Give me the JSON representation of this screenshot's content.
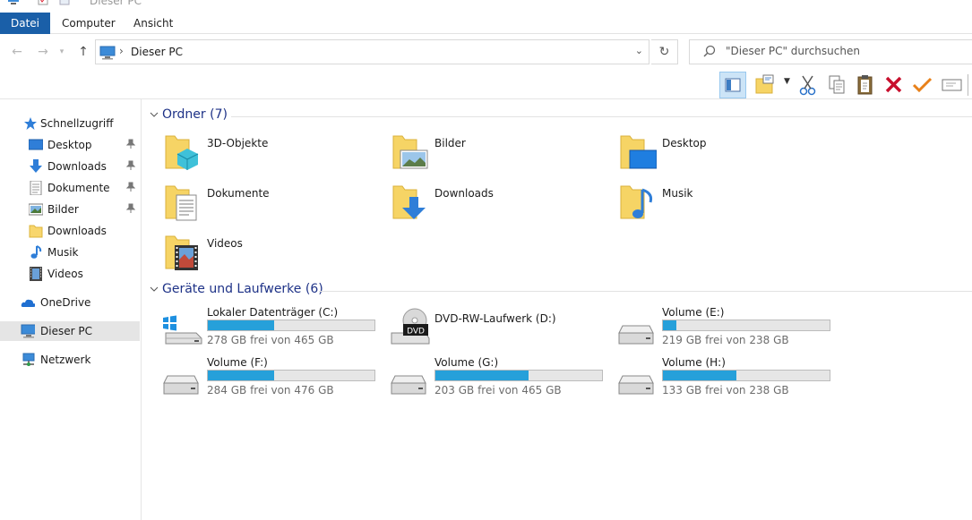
{
  "window": {
    "title": "Dieser PC"
  },
  "ribbon": {
    "tabs": [
      "Datei",
      "Computer",
      "Ansicht"
    ]
  },
  "address": {
    "path": "Dieser PC"
  },
  "search": {
    "placeholder": "\"Dieser PC\" durchsuchen"
  },
  "sidebar": {
    "quick_access": "Schnellzugriff",
    "items": [
      {
        "label": "Desktop",
        "icon": "desktop-icon",
        "pinned": true
      },
      {
        "label": "Downloads",
        "icon": "download-icon",
        "pinned": true
      },
      {
        "label": "Dokumente",
        "icon": "document-icon",
        "pinned": true
      },
      {
        "label": "Bilder",
        "icon": "pictures-icon",
        "pinned": true
      },
      {
        "label": "Downloads",
        "icon": "folder-icon",
        "pinned": false
      },
      {
        "label": "Musik",
        "icon": "music-icon",
        "pinned": false
      },
      {
        "label": "Videos",
        "icon": "video-icon",
        "pinned": false
      }
    ],
    "onedrive": "OneDrive",
    "this_pc": "Dieser PC",
    "network": "Netzwerk"
  },
  "folders_group": {
    "title": "Ordner (7)",
    "items": [
      {
        "label": "3D-Objekte",
        "icon": "3d-objects-icon"
      },
      {
        "label": "Bilder",
        "icon": "pictures-folder-icon"
      },
      {
        "label": "Desktop",
        "icon": "desktop-folder-icon"
      },
      {
        "label": "Dokumente",
        "icon": "documents-folder-icon"
      },
      {
        "label": "Downloads",
        "icon": "downloads-folder-icon"
      },
      {
        "label": "Musik",
        "icon": "music-folder-icon"
      },
      {
        "label": "Videos",
        "icon": "videos-folder-icon"
      }
    ]
  },
  "drives_group": {
    "title": "Geräte und Laufwerke (6)",
    "drives": [
      {
        "name": "Lokaler Datenträger (C:)",
        "free": "278 GB frei von 465 GB",
        "used_fraction": 0.4,
        "type": "system"
      },
      {
        "name": "DVD-RW-Laufwerk (D:)",
        "free": "",
        "used_fraction": null,
        "type": "dvd"
      },
      {
        "name": "Volume (E:)",
        "free": "219 GB frei von 238 GB",
        "used_fraction": 0.08,
        "type": "hdd"
      },
      {
        "name": "Volume (F:)",
        "free": "284 GB frei von 476 GB",
        "used_fraction": 0.4,
        "type": "hdd"
      },
      {
        "name": "Volume (G:)",
        "free": "203 GB frei von 465 GB",
        "used_fraction": 0.56,
        "type": "hdd"
      },
      {
        "name": "Volume (H:)",
        "free": "133 GB frei von 238 GB",
        "used_fraction": 0.44,
        "type": "hdd"
      }
    ]
  },
  "dvd_label": "DVD",
  "colors": {
    "accent": "#1a5fa8",
    "bar_fill": "#26a0da",
    "group_title": "#1e3287"
  }
}
